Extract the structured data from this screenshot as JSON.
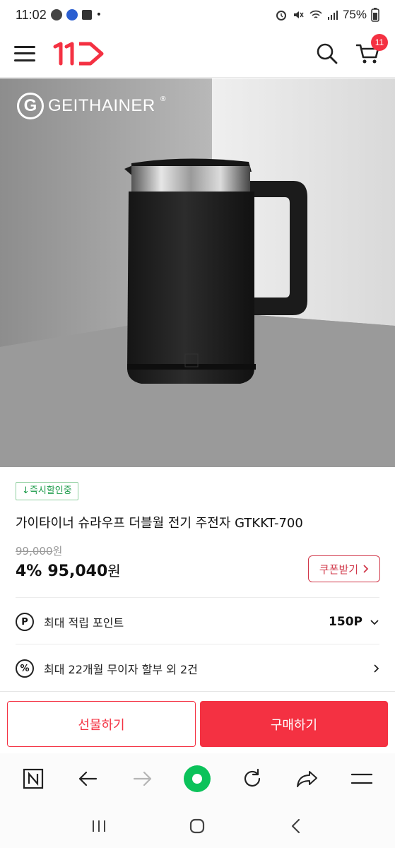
{
  "status_bar": {
    "time": "11:02",
    "battery": "75%"
  },
  "header": {
    "logo_text": "11",
    "cart_count": "11"
  },
  "product": {
    "brand_logo": "GEITHAINER",
    "brand_initial": "G",
    "brand_reg": "®",
    "discount_tag": "↓즉시할인중",
    "title": "가이타이너 슈라우프 더블월 전기 주전자 GTKKT-700",
    "original_price": "99,000",
    "original_price_unit": "원",
    "discount_rate": "4%",
    "sale_price": "95,040",
    "sale_price_unit": "원",
    "coupon_label": "쿠폰받기"
  },
  "benefits": {
    "points_icon": "P",
    "points_label": "최대 적립 포인트",
    "points_value": "150P",
    "installment_icon": "%",
    "installment_label": "최대 22개월 무이자 할부 외 2건"
  },
  "buy_bar": {
    "gift_label": "선물하기",
    "purchase_label": "구매하기"
  },
  "colors": {
    "brand_red": "#f43142",
    "coupon_red": "#d1384a",
    "instant_green": "#1a9a48",
    "browser_green": "#0bc25a"
  },
  "icons": {
    "header": [
      "menu-icon",
      "search-icon",
      "cart-icon"
    ],
    "browser": [
      "naver-n-icon",
      "back-arrow-icon",
      "forward-arrow-icon",
      "green-home-icon",
      "reload-icon",
      "share-icon",
      "more-menu-icon"
    ],
    "system": [
      "recent-apps-icon",
      "home-icon",
      "back-icon"
    ]
  }
}
